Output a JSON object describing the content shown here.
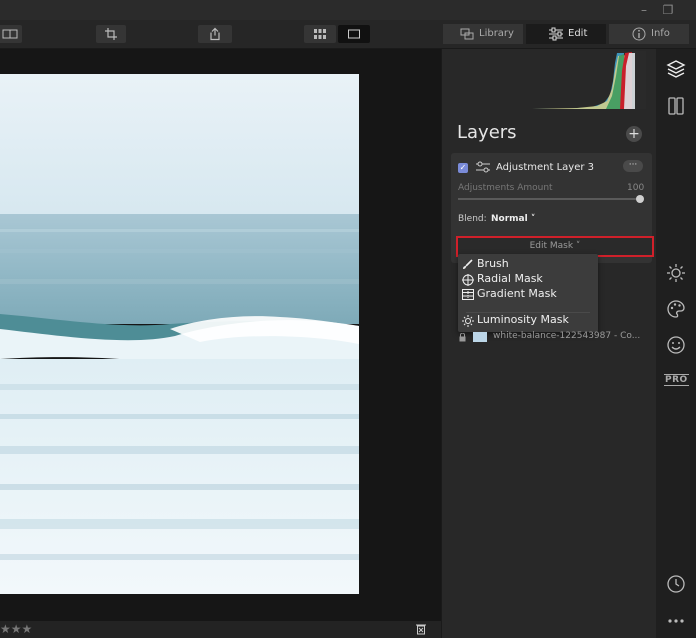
{
  "window": {
    "restore_icon": "restore-icon",
    "minimize_icon": "minimize-icon"
  },
  "toolbar": {
    "tools": [
      "compare-icon",
      "crop-icon",
      "export-icon",
      "grid-view-icon",
      "single-view-icon"
    ],
    "modes": [
      {
        "label": "Library",
        "icon": "library-icon"
      },
      {
        "label": "Edit",
        "icon": "sliders-icon"
      },
      {
        "label": "Info",
        "icon": "info-icon"
      }
    ],
    "active_mode": "Edit"
  },
  "layers": {
    "title": "Layers",
    "add_button": "+",
    "adjustment_layer": {
      "checked": true,
      "name": "Adjustment Layer 3",
      "more": "···",
      "amount_label": "Adjustments Amount",
      "amount_value": "100",
      "amount_fraction": 1.0,
      "blend_label": "Blend:",
      "blend_value": "Normal ˅"
    },
    "edit_mask_label": "Edit Mask ˅",
    "mask_menu": [
      {
        "label": "Brush",
        "icon": "brush-icon"
      },
      {
        "label": "Radial Mask",
        "icon": "radial-mask-icon"
      },
      {
        "label": "Gradient Mask",
        "icon": "gradient-mask-icon"
      },
      {
        "label": "Luminosity Mask",
        "icon": "luminosity-mask-icon"
      }
    ],
    "base_layer": {
      "name": "white-balance-122543987 - Co..."
    }
  },
  "right_sidebar": {
    "icons": [
      "layers-icon",
      "presets-icon",
      "essentials-sun-icon",
      "creative-palette-icon",
      "portrait-face-icon",
      "history-clock-icon",
      "more-icon"
    ],
    "pro_label": "PRO"
  },
  "bottom": {
    "rating": "★★★",
    "trash_icon": "trash-icon"
  },
  "colors": {
    "accent_red": "#d0202a",
    "checkbox": "#7a8bd8"
  }
}
